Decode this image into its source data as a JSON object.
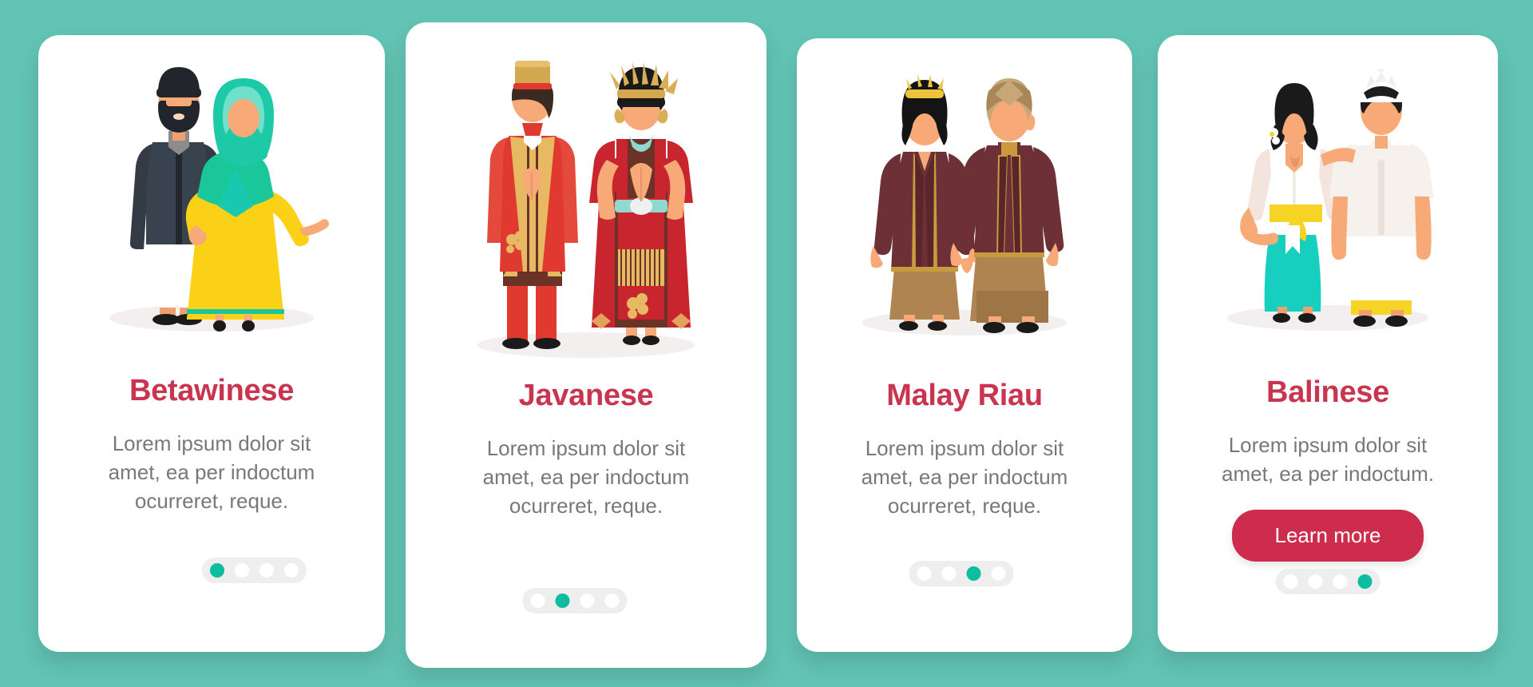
{
  "theme": {
    "background_color": "#62c4b4",
    "card_color": "#ffffff",
    "title_color": "#c9344e",
    "body_text_color": "#76787a",
    "accent_color": "#0dbda0",
    "button_color": "#ce2c4c",
    "dots_track_color": "#eeeeee"
  },
  "cards": [
    {
      "title": "Betawinese",
      "description": "Lorem ipsum dolor sit amet, ea per indoctum ocurreret, reque.",
      "illustration": "betawinese-couple-illustration",
      "dots": {
        "count": 4,
        "active_index": 0
      },
      "cta": null
    },
    {
      "title": "Javanese",
      "description": "Lorem ipsum dolor sit amet, ea per indoctum ocurreret, reque.",
      "illustration": "javanese-couple-illustration",
      "dots": {
        "count": 4,
        "active_index": 1
      },
      "cta": null
    },
    {
      "title": "Malay Riau",
      "description": "Lorem ipsum dolor sit amet, ea per indoctum ocurreret, reque.",
      "illustration": "malay-riau-couple-illustration",
      "dots": {
        "count": 4,
        "active_index": 2
      },
      "cta": null
    },
    {
      "title": "Balinese",
      "description": "Lorem ipsum dolor sit amet, ea per indoctum.",
      "illustration": "balinese-couple-illustration",
      "dots": {
        "count": 4,
        "active_index": 3
      },
      "cta": {
        "label": "Learn more"
      }
    }
  ]
}
